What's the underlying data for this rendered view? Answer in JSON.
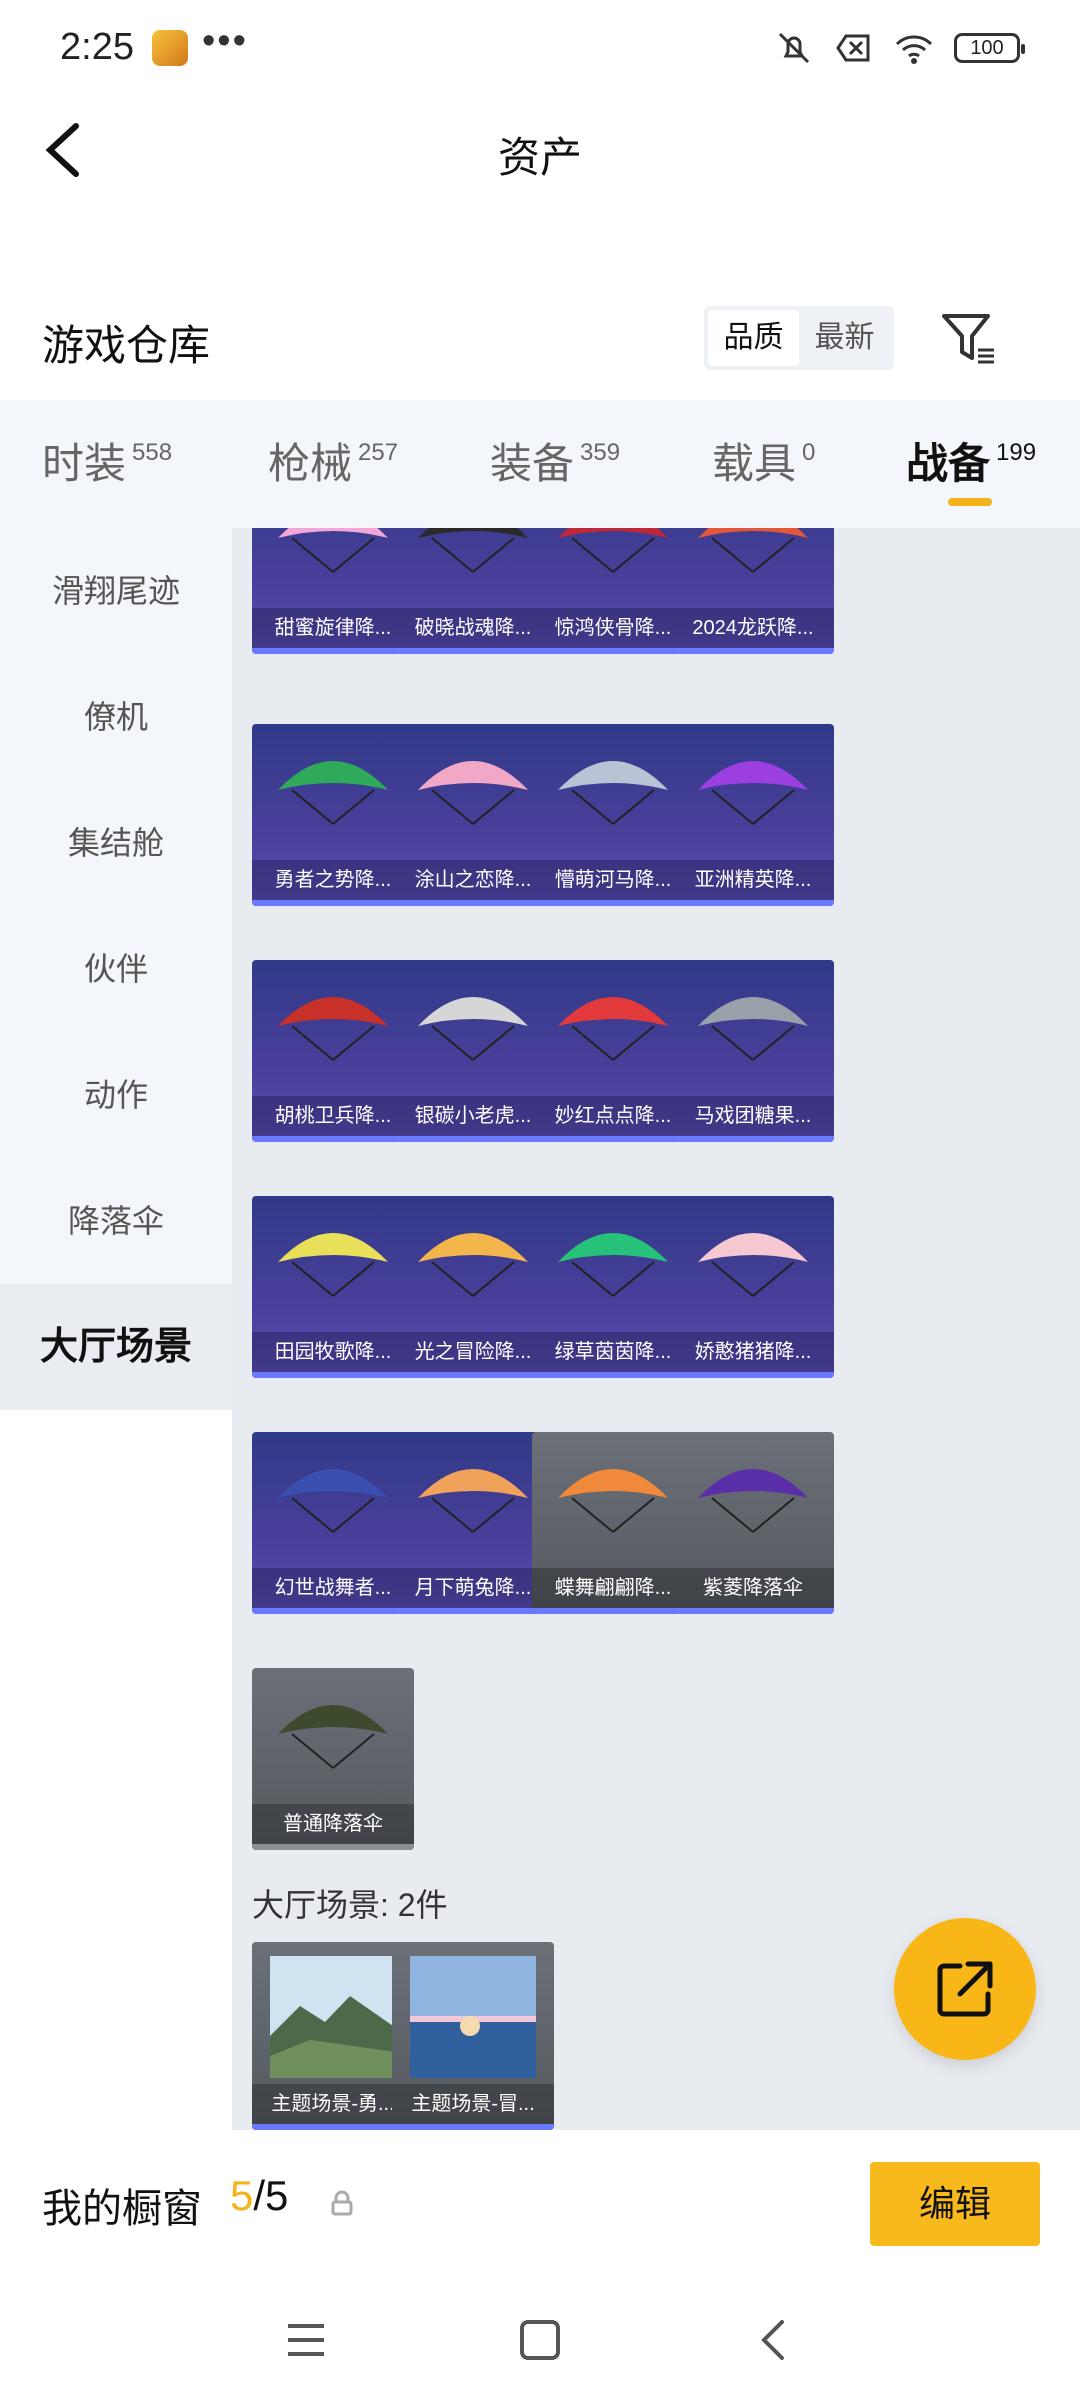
{
  "status_bar": {
    "time": "2:25",
    "more": "•••",
    "battery": "100"
  },
  "header": {
    "title": "资产"
  },
  "warehouse": {
    "title": "游戏仓库",
    "sort_options": [
      "品质",
      "最新"
    ]
  },
  "tabs": [
    {
      "label": "时装",
      "count": "558"
    },
    {
      "label": "枪械",
      "count": "257"
    },
    {
      "label": "装备",
      "count": "359"
    },
    {
      "label": "载具",
      "count": "0"
    },
    {
      "label": "战备",
      "count": "199"
    }
  ],
  "sidebar": [
    "滑翔尾迹",
    "僚机",
    "集结舱",
    "伙伴",
    "动作",
    "降落伞",
    "大厅场景"
  ],
  "items": [
    {
      "name": "甜蜜旋律降...",
      "color": "#f2a7d8"
    },
    {
      "name": "破晓战魂降...",
      "color": "#2a2a2a"
    },
    {
      "name": "惊鸿侠骨降...",
      "color": "#c0283a"
    },
    {
      "name": "2024龙跃降...",
      "color": "#e2573a"
    },
    {
      "name": "勇者之势降...",
      "color": "#2eaa5a"
    },
    {
      "name": "涂山之恋降...",
      "color": "#f0a8c6"
    },
    {
      "name": "懵萌河马降...",
      "color": "#b9c3d6"
    },
    {
      "name": "亚洲精英降...",
      "color": "#9b3fe0"
    },
    {
      "name": "胡桃卫兵降...",
      "color": "#c8302a"
    },
    {
      "name": "银碳小老虎...",
      "color": "#d6d6d6"
    },
    {
      "name": "妙红点点降...",
      "color": "#e23a3a"
    },
    {
      "name": "马戏团糖果...",
      "color": "#9aa0aa"
    },
    {
      "name": "田园牧歌降...",
      "color": "#e9e05a"
    },
    {
      "name": "光之冒险降...",
      "color": "#f2b64a"
    },
    {
      "name": "绿草茵茵降...",
      "color": "#27c27a"
    },
    {
      "name": "娇憨猪猪降...",
      "color": "#f6c9d2"
    },
    {
      "name": "幻世战舞者...",
      "color": "#3a4fb0"
    },
    {
      "name": "月下萌兔降...",
      "color": "#f0a25a"
    },
    {
      "name": "蝶舞翩翩降...",
      "color": "#f08a3a"
    },
    {
      "name": "紫菱降落伞",
      "color": "#5a2ea8"
    },
    {
      "name": "普通降落伞",
      "color": "#3e4a2e"
    }
  ],
  "lobby": {
    "section_label": "大厅场景: 2件",
    "items": [
      "主题场景-勇...",
      "主题场景-冒..."
    ]
  },
  "showcase": {
    "label": "我的橱窗",
    "current": "5",
    "total": "/5",
    "edit": "编辑"
  }
}
